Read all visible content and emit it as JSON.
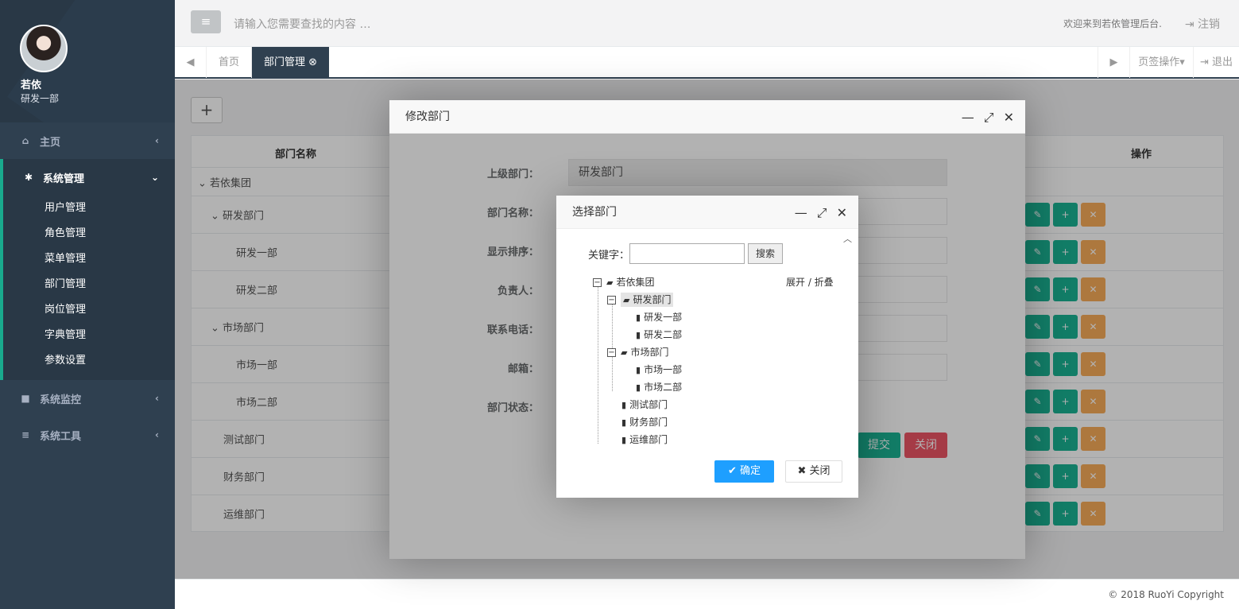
{
  "sidebar": {
    "user_name": "若依",
    "user_dept": "研发一部",
    "menu": [
      {
        "label": "主页",
        "icon": "home-icon"
      },
      {
        "label": "系统管理",
        "icon": "gear-icon"
      },
      {
        "label": "系统监控",
        "icon": "video-icon"
      },
      {
        "label": "系统工具",
        "icon": "bars-icon"
      }
    ],
    "sub_items": [
      "用户管理",
      "角色管理",
      "菜单管理",
      "部门管理",
      "岗位管理",
      "字典管理",
      "参数设置"
    ]
  },
  "header": {
    "search_placeholder": "请输入您需要查找的内容 …",
    "welcome": "欢迎来到若依管理后台.",
    "logout": "注销"
  },
  "tabs": {
    "home": "首页",
    "active": "部门管理",
    "ops": "页签操作",
    "exit": "退出"
  },
  "table": {
    "col_name": "部门名称",
    "col_ops": "操作",
    "rows": [
      "若依集团",
      "研发部门",
      "研发一部",
      "研发二部",
      "市场部门",
      "市场一部",
      "市场二部",
      "测试部门",
      "财务部门",
      "运维部门"
    ]
  },
  "edit_dialog": {
    "title": "修改部门",
    "fields": {
      "parent_label": "上级部门：",
      "parent_value": "研发部门",
      "name_label": "部门名称：",
      "order_label": "显示排序：",
      "leader_label": "负责人：",
      "phone_label": "联系电话：",
      "email_label": "邮箱：",
      "status_label": "部门状态："
    },
    "submit": "提交",
    "close": "关闭"
  },
  "select_dialog": {
    "title": "选择部门",
    "keyword_label": "关键字：",
    "search_button": "搜索",
    "expand_collapse": "展开 / 折叠",
    "tree": {
      "root": "若依集团",
      "rd": "研发部门",
      "rd1": "研发一部",
      "rd2": "研发二部",
      "mk": "市场部门",
      "mk1": "市场一部",
      "mk2": "市场二部",
      "test": "测试部门",
      "fin": "财务部门",
      "ops": "运维部门"
    },
    "ok": "确定",
    "close": "关闭"
  },
  "footer": "© 2018 RuoYi Copyright"
}
